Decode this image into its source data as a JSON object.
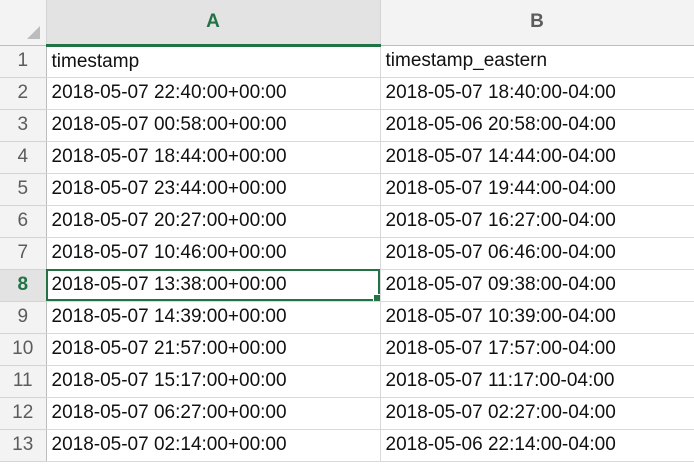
{
  "columns": [
    {
      "letter": "A",
      "active": true
    },
    {
      "letter": "B",
      "active": false
    }
  ],
  "rows": [
    {
      "num": "1",
      "a": "timestamp",
      "b": "timestamp_eastern"
    },
    {
      "num": "2",
      "a": "2018-05-07 22:40:00+00:00",
      "b": "2018-05-07 18:40:00-04:00"
    },
    {
      "num": "3",
      "a": "2018-05-07 00:58:00+00:00",
      "b": "2018-05-06 20:58:00-04:00"
    },
    {
      "num": "4",
      "a": "2018-05-07 18:44:00+00:00",
      "b": "2018-05-07 14:44:00-04:00"
    },
    {
      "num": "5",
      "a": "2018-05-07 23:44:00+00:00",
      "b": "2018-05-07 19:44:00-04:00"
    },
    {
      "num": "6",
      "a": "2018-05-07 20:27:00+00:00",
      "b": "2018-05-07 16:27:00-04:00"
    },
    {
      "num": "7",
      "a": "2018-05-07 10:46:00+00:00",
      "b": "2018-05-07 06:46:00-04:00"
    },
    {
      "num": "8",
      "a": "2018-05-07 13:38:00+00:00",
      "b": "2018-05-07 09:38:00-04:00"
    },
    {
      "num": "9",
      "a": "2018-05-07 14:39:00+00:00",
      "b": "2018-05-07 10:39:00-04:00"
    },
    {
      "num": "10",
      "a": "2018-05-07 21:57:00+00:00",
      "b": "2018-05-07 17:57:00-04:00"
    },
    {
      "num": "11",
      "a": "2018-05-07 15:17:00+00:00",
      "b": "2018-05-07 11:17:00-04:00"
    },
    {
      "num": "12",
      "a": "2018-05-07 06:27:00+00:00",
      "b": "2018-05-07 02:27:00-04:00"
    },
    {
      "num": "13",
      "a": "2018-05-07 02:14:00+00:00",
      "b": "2018-05-06 22:14:00-04:00"
    }
  ],
  "selection": {
    "row": "8",
    "column": "A"
  },
  "colors": {
    "accent": "#217346",
    "header_bg": "#f3f3f3",
    "grid_line": "#d9d9d9"
  }
}
